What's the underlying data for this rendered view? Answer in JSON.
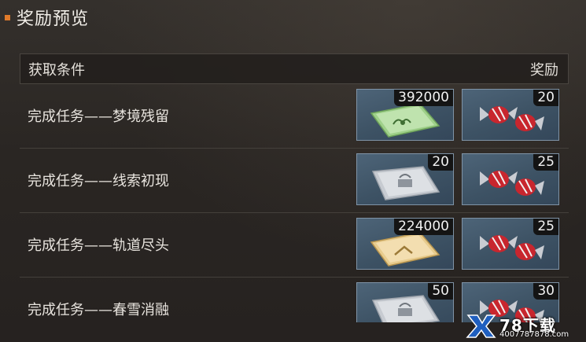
{
  "header": {
    "title": "奖励预览"
  },
  "table": {
    "col_condition": "获取条件",
    "col_reward": "奖励"
  },
  "rows": [
    {
      "label": "完成任务——梦境残留",
      "rewards": [
        {
          "icon": "green-envelope-icon",
          "count": "392000"
        },
        {
          "icon": "candy-icon",
          "count": "20"
        }
      ]
    },
    {
      "label": "完成任务——线索初现",
      "rewards": [
        {
          "icon": "gray-pouch-icon",
          "count": "20"
        },
        {
          "icon": "candy-icon",
          "count": "25"
        }
      ]
    },
    {
      "label": "完成任务——轨道尽头",
      "rewards": [
        {
          "icon": "gold-envelope-icon",
          "count": "224000"
        },
        {
          "icon": "candy-icon",
          "count": "25"
        }
      ]
    },
    {
      "label": "完成任务——春雪消融",
      "rewards": [
        {
          "icon": "gray-pouch-icon",
          "count": "50"
        },
        {
          "icon": "candy-icon",
          "count": "30"
        }
      ]
    }
  ],
  "watermark": {
    "text": "78下载",
    "sub": "4007787878.com"
  },
  "colors": {
    "accent": "#e07a2a",
    "reward_border": "#7f93a6"
  }
}
